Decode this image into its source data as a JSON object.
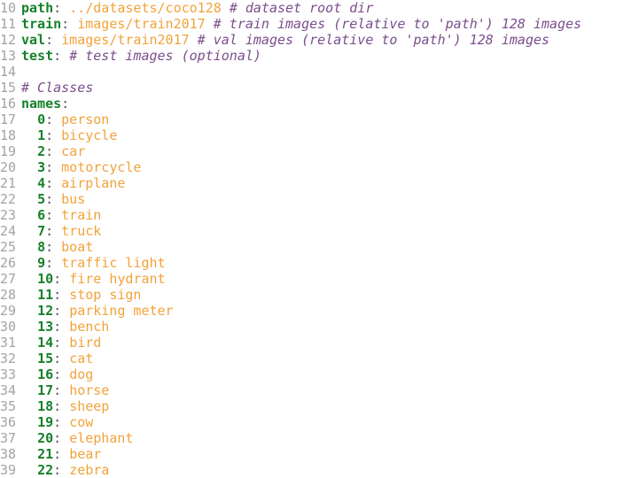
{
  "editor": {
    "colors": {
      "line_number": "#a3a3a3",
      "key": "#16802a",
      "value": "#f2a23a",
      "comment": "#7b4d8c",
      "background": "#ffffff"
    },
    "lines": [
      {
        "num": "10",
        "indent": "",
        "key": "path",
        "value": "../datasets/coco128",
        "comment": "# dataset root dir"
      },
      {
        "num": "11",
        "indent": "",
        "key": "train",
        "value": "images/train2017",
        "comment": "# train images (relative to 'path') 128 images"
      },
      {
        "num": "12",
        "indent": "",
        "key": "val",
        "value": "images/train2017",
        "comment": "# val images (relative to 'path') 128 images"
      },
      {
        "num": "13",
        "indent": "",
        "key": "test",
        "value": "",
        "comment": "# test images (optional)"
      },
      {
        "num": "14",
        "indent": "",
        "key": "",
        "value": "",
        "comment": ""
      },
      {
        "num": "15",
        "indent": "",
        "key": "",
        "value": "",
        "comment": "# Classes"
      },
      {
        "num": "16",
        "indent": "",
        "key": "names",
        "value": "",
        "comment": ""
      },
      {
        "num": "17",
        "indent": "  ",
        "key": "0",
        "value": "person",
        "comment": ""
      },
      {
        "num": "18",
        "indent": "  ",
        "key": "1",
        "value": "bicycle",
        "comment": ""
      },
      {
        "num": "19",
        "indent": "  ",
        "key": "2",
        "value": "car",
        "comment": ""
      },
      {
        "num": "20",
        "indent": "  ",
        "key": "3",
        "value": "motorcycle",
        "comment": ""
      },
      {
        "num": "21",
        "indent": "  ",
        "key": "4",
        "value": "airplane",
        "comment": ""
      },
      {
        "num": "22",
        "indent": "  ",
        "key": "5",
        "value": "bus",
        "comment": ""
      },
      {
        "num": "23",
        "indent": "  ",
        "key": "6",
        "value": "train",
        "comment": ""
      },
      {
        "num": "24",
        "indent": "  ",
        "key": "7",
        "value": "truck",
        "comment": ""
      },
      {
        "num": "25",
        "indent": "  ",
        "key": "8",
        "value": "boat",
        "comment": ""
      },
      {
        "num": "26",
        "indent": "  ",
        "key": "9",
        "value": "traffic light",
        "comment": ""
      },
      {
        "num": "27",
        "indent": "  ",
        "key": "10",
        "value": "fire hydrant",
        "comment": ""
      },
      {
        "num": "28",
        "indent": "  ",
        "key": "11",
        "value": "stop sign",
        "comment": ""
      },
      {
        "num": "29",
        "indent": "  ",
        "key": "12",
        "value": "parking meter",
        "comment": ""
      },
      {
        "num": "30",
        "indent": "  ",
        "key": "13",
        "value": "bench",
        "comment": ""
      },
      {
        "num": "31",
        "indent": "  ",
        "key": "14",
        "value": "bird",
        "comment": ""
      },
      {
        "num": "32",
        "indent": "  ",
        "key": "15",
        "value": "cat",
        "comment": ""
      },
      {
        "num": "33",
        "indent": "  ",
        "key": "16",
        "value": "dog",
        "comment": ""
      },
      {
        "num": "34",
        "indent": "  ",
        "key": "17",
        "value": "horse",
        "comment": ""
      },
      {
        "num": "35",
        "indent": "  ",
        "key": "18",
        "value": "sheep",
        "comment": ""
      },
      {
        "num": "36",
        "indent": "  ",
        "key": "19",
        "value": "cow",
        "comment": ""
      },
      {
        "num": "37",
        "indent": "  ",
        "key": "20",
        "value": "elephant",
        "comment": ""
      },
      {
        "num": "38",
        "indent": "  ",
        "key": "21",
        "value": "bear",
        "comment": ""
      },
      {
        "num": "39",
        "indent": "  ",
        "key": "22",
        "value": "zebra",
        "comment": ""
      }
    ]
  }
}
